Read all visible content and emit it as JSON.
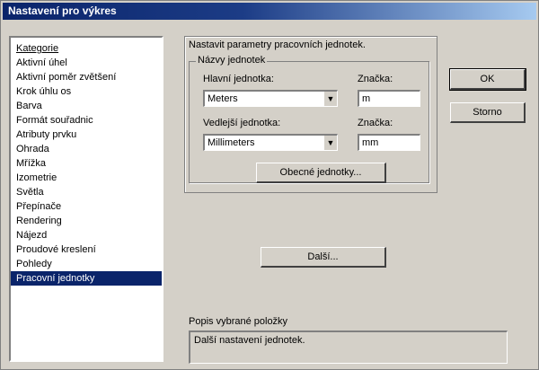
{
  "window": {
    "title": "Nastavení pro výkres"
  },
  "categories": {
    "header": "Kategorie",
    "items": [
      "Aktivní úhel",
      "Aktivní poměr zvětšení",
      "Krok úhlu os",
      "Barva",
      "Formát souřadnic",
      "Atributy prvku",
      "Ohrada",
      "Mřížka",
      "Izometrie",
      "Světla",
      "Přepínače",
      "Rendering",
      "Nájezd",
      "Proudové kreslení",
      "Pohledy",
      "Pracovní jednotky"
    ],
    "selected": "Pracovní jednotky"
  },
  "panel": {
    "heading": "Nastavit parametry pracovních jednotek.",
    "group_title": "Názvy jednotek",
    "main_unit_label": "Hlavní jednotka:",
    "main_unit_value": "Meters",
    "main_symbol_label": "Značka:",
    "main_symbol_value": "m",
    "sub_unit_label": "Vedlejší jednotka:",
    "sub_unit_value": "Millimeters",
    "sub_symbol_label": "Značka:",
    "sub_symbol_value": "mm",
    "custom_units_button": "Obecné jednotky...",
    "next_button": "Další..."
  },
  "buttons": {
    "ok": "OK",
    "cancel": "Storno"
  },
  "description": {
    "label": "Popis vybrané položky",
    "text": "Další nastavení jednotek."
  }
}
